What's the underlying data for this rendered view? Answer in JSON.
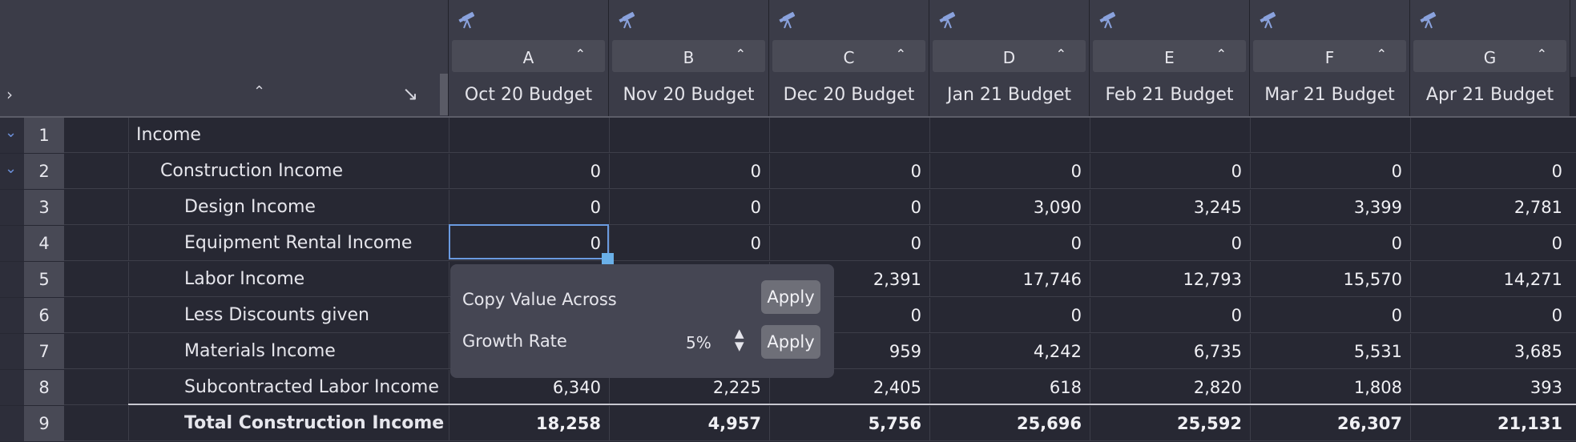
{
  "columns": [
    {
      "letter": "A",
      "name": "Oct 20 Budget"
    },
    {
      "letter": "B",
      "name": "Nov 20 Budget"
    },
    {
      "letter": "C",
      "name": "Dec 20 Budget"
    },
    {
      "letter": "D",
      "name": "Jan 21 Budget"
    },
    {
      "letter": "E",
      "name": "Feb 21 Budget"
    },
    {
      "letter": "F",
      "name": "Mar 21 Budget"
    },
    {
      "letter": "G",
      "name": "Apr 21 Budget"
    }
  ],
  "rows": [
    {
      "num": "1",
      "label": "Income",
      "values": [
        "",
        "",
        "",
        "",
        "",
        "",
        ""
      ]
    },
    {
      "num": "2",
      "label": "Construction Income",
      "values": [
        "0",
        "0",
        "0",
        "0",
        "0",
        "0",
        "0"
      ]
    },
    {
      "num": "3",
      "label": "Design Income",
      "values": [
        "0",
        "0",
        "0",
        "3,090",
        "3,245",
        "3,399",
        "2,781"
      ]
    },
    {
      "num": "4",
      "label": "Equipment Rental Income",
      "values": [
        "0",
        "0",
        "0",
        "0",
        "0",
        "0",
        "0"
      ]
    },
    {
      "num": "5",
      "label": "Labor Income",
      "values": [
        "",
        "",
        "2,391",
        "17,746",
        "12,793",
        "15,570",
        "14,271"
      ]
    },
    {
      "num": "6",
      "label": "Less Discounts given",
      "values": [
        "",
        "",
        "0",
        "0",
        "0",
        "0",
        "0"
      ]
    },
    {
      "num": "7",
      "label": "Materials Income",
      "values": [
        "",
        "",
        "959",
        "4,242",
        "6,735",
        "5,531",
        "3,685"
      ]
    },
    {
      "num": "8",
      "label": "Subcontracted Labor Income",
      "values": [
        "6,340",
        "2,225",
        "2,405",
        "618",
        "2,820",
        "1,808",
        "393"
      ]
    },
    {
      "num": "9",
      "label": "Total Construction Income",
      "values": [
        "18,258",
        "4,957",
        "5,756",
        "25,696",
        "25,592",
        "26,307",
        "21,131"
      ]
    }
  ],
  "popup": {
    "copy_label": "Copy Value Across",
    "growth_label": "Growth Rate",
    "growth_value": "5%",
    "apply_label": "Apply"
  },
  "icons": {
    "expand_all": "chevron-right-icon",
    "sort": "sort-updown-icon",
    "collapse_arrow": "arrow-down-right-icon",
    "column_scope": "telescope-icon",
    "row_toggle": "chevron-down-icon"
  },
  "colors": {
    "background": "#272833",
    "header": "#3b3c48",
    "selection": "#6a9ae0",
    "accent_chevron": "#6b8fd8"
  }
}
